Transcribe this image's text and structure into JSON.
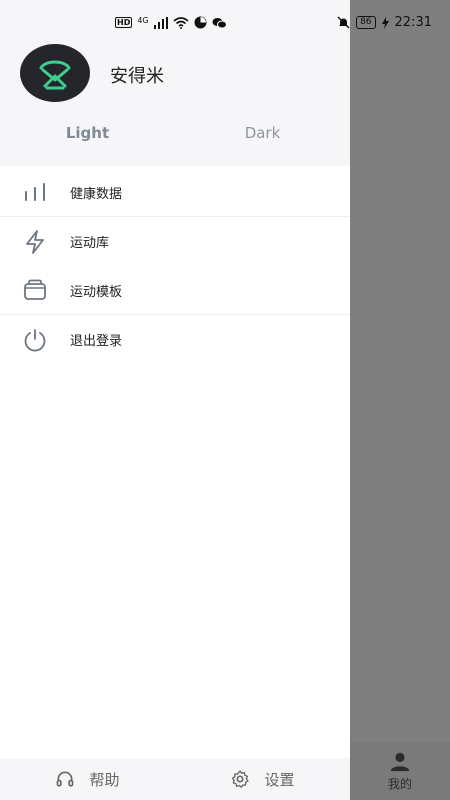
{
  "status_bar": {
    "hd": "HD",
    "network": "4G",
    "battery": "86",
    "time": "22:31"
  },
  "profile": {
    "name": "安得米"
  },
  "theme": {
    "light_label": "Light",
    "dark_label": "Dark",
    "selected": "Light"
  },
  "menu": {
    "items": [
      {
        "label": "健康数据",
        "icon": "bar-chart-icon"
      },
      {
        "label": "运动库",
        "icon": "lightning-icon"
      },
      {
        "label": "运动模板",
        "icon": "template-icon"
      },
      {
        "label": "退出登录",
        "icon": "power-icon"
      }
    ]
  },
  "footer": {
    "help_label": "帮助",
    "settings_label": "设置"
  },
  "background_tab": {
    "label": "我的"
  },
  "colors": {
    "accent_green": "#3ecf8e",
    "avatar_bg": "#25252c",
    "backdrop": "#7f7f7f"
  }
}
